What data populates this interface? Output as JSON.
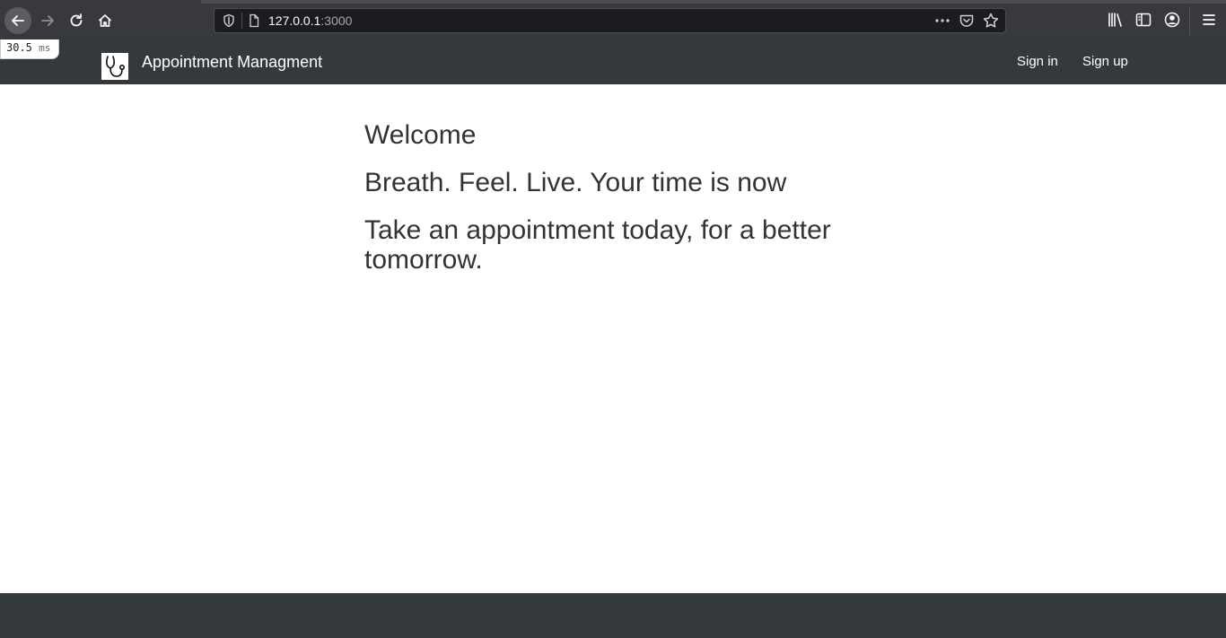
{
  "browser": {
    "url_host": "127.0.0.1",
    "url_port": ":3000"
  },
  "perf": {
    "value": "30.5",
    "unit": "ms"
  },
  "navbar": {
    "brand": "Appointment Managment",
    "links": {
      "signin": "Sign in",
      "signup": "Sign up"
    }
  },
  "hero": {
    "welcome": "Welcome",
    "tagline": "Breath. Feel. Live. Your time is now",
    "cta_text": "Take an appointment today, for a better tomorrow."
  },
  "colors": {
    "navbar_bg": "#343a3c",
    "browser_bg": "#38393d",
    "text": "#333333"
  }
}
